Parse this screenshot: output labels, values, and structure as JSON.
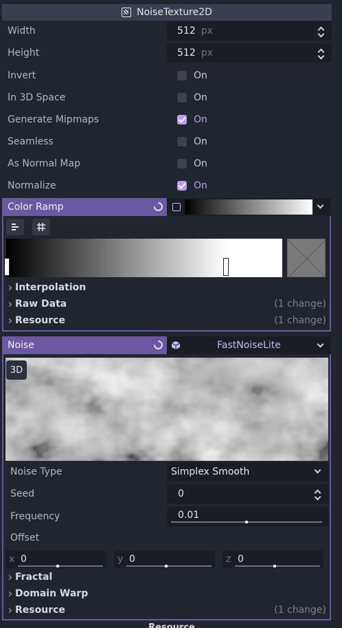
{
  "inspector": {
    "resource_type": "NoiseTexture2D",
    "resource_icon": "noise-texture-icon"
  },
  "properties": [
    {
      "label": "Width",
      "value": "512",
      "unit": "px"
    },
    {
      "label": "Height",
      "value": "512",
      "unit": "px"
    }
  ],
  "checkboxes": [
    {
      "label": "Invert",
      "text": "On",
      "checked": false
    },
    {
      "label": "In 3D Space",
      "text": "On",
      "checked": false
    },
    {
      "label": "Generate Mipmaps",
      "text": "On",
      "checked": true
    },
    {
      "label": "Seamless",
      "text": "On",
      "checked": false
    },
    {
      "label": "As Normal Map",
      "text": "On",
      "checked": false
    },
    {
      "label": "Normalize",
      "text": "On",
      "checked": true
    }
  ],
  "color_ramp": {
    "label": "Color Ramp",
    "subsections": [
      {
        "label": "Interpolation",
        "change": ""
      },
      {
        "label": "Raw Data",
        "change": "(1 change)"
      },
      {
        "label": "Resource",
        "change": "(1 change)"
      }
    ],
    "gradient_stops": [
      0.0,
      0.8
    ]
  },
  "noise": {
    "label": "Noise",
    "resource_name": "FastNoiseLite",
    "preview_badge": "3D",
    "noise_type_label": "Noise Type",
    "noise_type_value": "Simplex Smooth",
    "seed_label": "Seed",
    "seed_value": "0",
    "frequency_label": "Frequency",
    "frequency_value": "0.01",
    "offset_label": "Offset",
    "offset": [
      {
        "axis": "x",
        "value": "0"
      },
      {
        "axis": "y",
        "value": "0"
      },
      {
        "axis": "z",
        "value": "0"
      }
    ],
    "subsections": [
      {
        "label": "Fractal",
        "change": ""
      },
      {
        "label": "Domain Warp",
        "change": ""
      },
      {
        "label": "Resource",
        "change": "(1 change)"
      }
    ]
  },
  "bottom": {
    "label": "Resource"
  },
  "colors": {
    "accent": "#b79ef2",
    "section_header": "#6b58a3",
    "background": "#21252e",
    "field": "#1a1d24"
  }
}
